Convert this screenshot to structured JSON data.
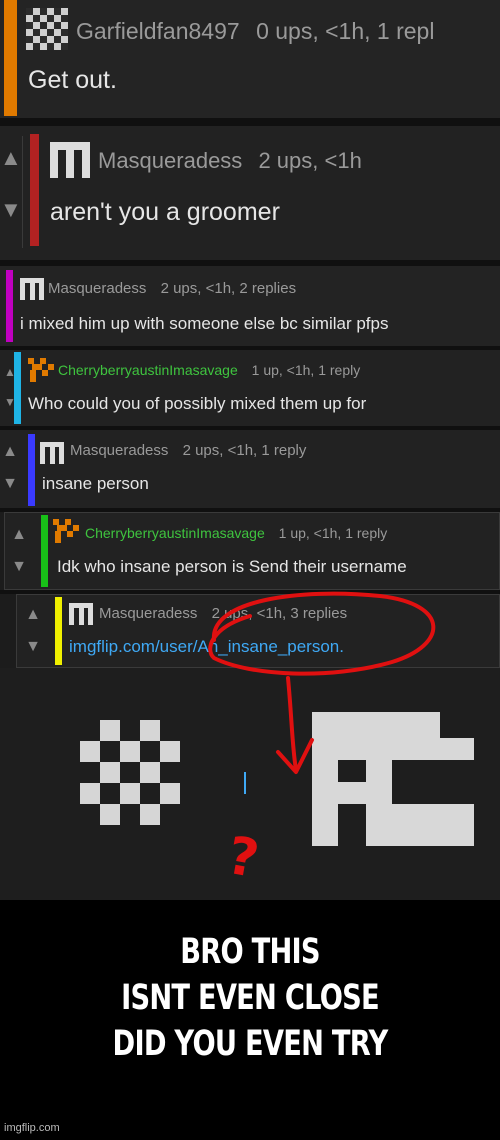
{
  "colors": {
    "orange": "#e07a00",
    "red": "#b22222",
    "magenta": "#c000c0",
    "cyan": "#1fb4e6",
    "blue": "#3a3aff",
    "green": "#18c018",
    "yellow": "#f0f000",
    "link": "#3fa9f5"
  },
  "comments": [
    {
      "user": "Garfieldfan8497",
      "stats": "0 ups, <1h, 1 repl",
      "text": "Get out.",
      "avatar": "checker-icon",
      "bar": "orange"
    },
    {
      "user": "Masqueradess",
      "stats": "2 ups, <1h",
      "text": "aren't you a groomer",
      "avatar": "masq-icon",
      "bar": "red"
    },
    {
      "user": "Masqueradess",
      "stats": "2 ups, <1h, 2 replies",
      "text": "i mixed him up with someone else bc similar pfps",
      "avatar": "masq-icon",
      "bar": "magenta"
    },
    {
      "user": "CherryberryaustinImasavage",
      "stats": "1 up, <1h, 1 reply",
      "text": "Who could you of possibly mixed them up for",
      "avatar": "cherry-icon",
      "bar": "cyan"
    },
    {
      "user": "Masqueradess",
      "stats": "2 ups, <1h, 1 reply",
      "text": "insane person",
      "avatar": "masq-icon",
      "bar": "blue"
    },
    {
      "user": "CherryberryaustinImasavage",
      "stats": "1 up, <1h, 1 reply",
      "text": "Idk who insane person is Send their username",
      "avatar": "cherry-icon",
      "bar": "green"
    },
    {
      "user": "Masqueradess",
      "stats": "2 ups, <1h, 3 replies",
      "text": "imgflip.com/user/An_insane_person.",
      "avatar": "masq-icon",
      "bar": "yellow"
    }
  ],
  "annotation": {
    "question_mark": "?"
  },
  "caption": {
    "line1": "BRO THIS",
    "line2": "ISNT EVEN CLOSE",
    "line3": "DID YOU EVEN TRY"
  },
  "watermark": "imgflip.com"
}
